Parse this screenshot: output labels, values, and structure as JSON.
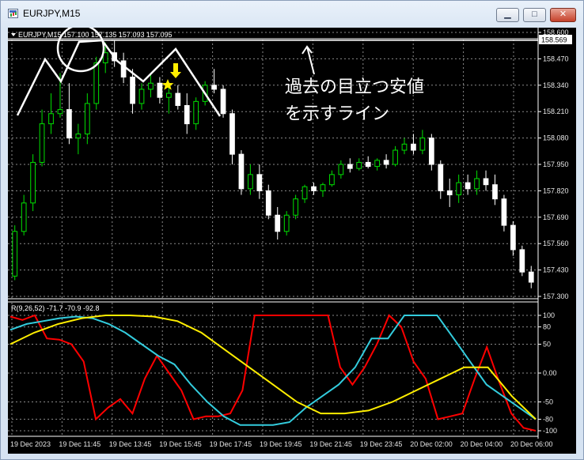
{
  "window": {
    "title": "EURJPY,M15",
    "min_glyph": "▁",
    "max_glyph": "□",
    "close_glyph": "✕"
  },
  "main_chart": {
    "header": "EURJPY,M15  157.100 157.135 157.093 157.095",
    "current_price": "158.569",
    "price_ticks": [
      "158.600",
      "158.470",
      "158.340",
      "158.210",
      "158.080",
      "157.950",
      "157.820",
      "157.690",
      "157.560",
      "157.430",
      "157.300"
    ],
    "price_range": [
      157.3,
      158.6
    ],
    "annotation_line1": "過去の目立つ安値",
    "annotation_line2": "を示すライン"
  },
  "indicator": {
    "header": "R(9,26,52) -71.7 -70.9 -92.8",
    "ticks": [
      "100",
      "80",
      "50",
      "0.00",
      "-50",
      "-80",
      "-100"
    ],
    "range": [
      -100,
      100
    ]
  },
  "time_axis": [
    "19 Dec 2023",
    "19 Dec 11:45",
    "19 Dec 13:45",
    "19 Dec 15:45",
    "19 Dec 17:45",
    "19 Dec 19:45",
    "19 Dec 21:45",
    "19 Dec 23:45",
    "20 Dec 02:00",
    "20 Dec 04:00",
    "20 Dec 06:00"
  ],
  "colors": {
    "up_candle": "#00e000",
    "down_candle": "#ffffff",
    "background": "#000000",
    "grid": "#8a8a8a",
    "price_line": "#ffffff",
    "red_line": "#ff0000",
    "cyan_line": "#33ccdd",
    "yellow_line": "#ffee00",
    "arrow": "#ffee00"
  },
  "chart_data": {
    "type": "candlestick",
    "title": "EURJPY,M15",
    "ylim": [
      157.3,
      158.6
    ],
    "candles": [
      {
        "o": 157.4,
        "h": 157.65,
        "l": 157.38,
        "c": 157.62
      },
      {
        "o": 157.62,
        "h": 157.8,
        "l": 157.6,
        "c": 157.76
      },
      {
        "o": 157.76,
        "h": 158.0,
        "l": 157.72,
        "c": 157.96
      },
      {
        "o": 157.96,
        "h": 158.22,
        "l": 157.94,
        "c": 158.15
      },
      {
        "o": 158.15,
        "h": 158.3,
        "l": 158.1,
        "c": 158.2
      },
      {
        "o": 158.2,
        "h": 158.4,
        "l": 158.18,
        "c": 158.22
      },
      {
        "o": 158.22,
        "h": 158.35,
        "l": 158.05,
        "c": 158.08
      },
      {
        "o": 158.08,
        "h": 158.15,
        "l": 158.0,
        "c": 158.1
      },
      {
        "o": 158.1,
        "h": 158.3,
        "l": 158.05,
        "c": 158.25
      },
      {
        "o": 158.25,
        "h": 158.48,
        "l": 158.22,
        "c": 158.45
      },
      {
        "o": 158.45,
        "h": 158.55,
        "l": 158.4,
        "c": 158.5
      },
      {
        "o": 158.5,
        "h": 158.56,
        "l": 158.43,
        "c": 158.46
      },
      {
        "o": 158.46,
        "h": 158.5,
        "l": 158.35,
        "c": 158.38
      },
      {
        "o": 158.38,
        "h": 158.42,
        "l": 158.2,
        "c": 158.25
      },
      {
        "o": 158.25,
        "h": 158.35,
        "l": 158.22,
        "c": 158.32
      },
      {
        "o": 158.32,
        "h": 158.4,
        "l": 158.28,
        "c": 158.35
      },
      {
        "o": 158.35,
        "h": 158.38,
        "l": 158.25,
        "c": 158.28
      },
      {
        "o": 158.28,
        "h": 158.34,
        "l": 158.2,
        "c": 158.3
      },
      {
        "o": 158.3,
        "h": 158.34,
        "l": 158.22,
        "c": 158.24
      },
      {
        "o": 158.24,
        "h": 158.3,
        "l": 158.1,
        "c": 158.15
      },
      {
        "o": 158.15,
        "h": 158.28,
        "l": 158.12,
        "c": 158.26
      },
      {
        "o": 158.26,
        "h": 158.36,
        "l": 158.24,
        "c": 158.34
      },
      {
        "o": 158.34,
        "h": 158.42,
        "l": 158.3,
        "c": 158.32
      },
      {
        "o": 158.32,
        "h": 158.34,
        "l": 158.18,
        "c": 158.2
      },
      {
        "o": 158.2,
        "h": 158.22,
        "l": 157.95,
        "c": 158.0
      },
      {
        "o": 158.0,
        "h": 158.02,
        "l": 157.8,
        "c": 157.83
      },
      {
        "o": 157.83,
        "h": 157.95,
        "l": 157.8,
        "c": 157.9
      },
      {
        "o": 157.9,
        "h": 157.95,
        "l": 157.78,
        "c": 157.82
      },
      {
        "o": 157.82,
        "h": 157.85,
        "l": 157.68,
        "c": 157.7
      },
      {
        "o": 157.7,
        "h": 157.74,
        "l": 157.58,
        "c": 157.62
      },
      {
        "o": 157.62,
        "h": 157.72,
        "l": 157.6,
        "c": 157.7
      },
      {
        "o": 157.7,
        "h": 157.8,
        "l": 157.68,
        "c": 157.78
      },
      {
        "o": 157.78,
        "h": 157.85,
        "l": 157.76,
        "c": 157.84
      },
      {
        "o": 157.84,
        "h": 157.86,
        "l": 157.8,
        "c": 157.82
      },
      {
        "o": 157.82,
        "h": 157.86,
        "l": 157.79,
        "c": 157.85
      },
      {
        "o": 157.85,
        "h": 157.92,
        "l": 157.84,
        "c": 157.9
      },
      {
        "o": 157.9,
        "h": 157.97,
        "l": 157.88,
        "c": 157.95
      },
      {
        "o": 157.95,
        "h": 157.98,
        "l": 157.91,
        "c": 157.93
      },
      {
        "o": 157.93,
        "h": 157.98,
        "l": 157.92,
        "c": 157.96
      },
      {
        "o": 157.96,
        "h": 157.99,
        "l": 157.93,
        "c": 157.94
      },
      {
        "o": 157.94,
        "h": 157.98,
        "l": 157.92,
        "c": 157.97
      },
      {
        "o": 157.97,
        "h": 158.0,
        "l": 157.93,
        "c": 157.95
      },
      {
        "o": 157.95,
        "h": 158.04,
        "l": 157.94,
        "c": 158.02
      },
      {
        "o": 158.02,
        "h": 158.08,
        "l": 158.0,
        "c": 158.05
      },
      {
        "o": 158.05,
        "h": 158.1,
        "l": 158.0,
        "c": 158.02
      },
      {
        "o": 158.02,
        "h": 158.12,
        "l": 158.0,
        "c": 158.08
      },
      {
        "o": 158.08,
        "h": 158.1,
        "l": 157.92,
        "c": 157.95
      },
      {
        "o": 157.95,
        "h": 157.97,
        "l": 157.78,
        "c": 157.82
      },
      {
        "o": 157.82,
        "h": 157.88,
        "l": 157.74,
        "c": 157.8
      },
      {
        "o": 157.8,
        "h": 157.9,
        "l": 157.76,
        "c": 157.86
      },
      {
        "o": 157.86,
        "h": 157.9,
        "l": 157.8,
        "c": 157.83
      },
      {
        "o": 157.83,
        "h": 157.92,
        "l": 157.8,
        "c": 157.88
      },
      {
        "o": 157.88,
        "h": 157.92,
        "l": 157.82,
        "c": 157.85
      },
      {
        "o": 157.85,
        "h": 157.9,
        "l": 157.75,
        "c": 157.78
      },
      {
        "o": 157.78,
        "h": 157.8,
        "l": 157.62,
        "c": 157.65
      },
      {
        "o": 157.65,
        "h": 157.67,
        "l": 157.5,
        "c": 157.53
      },
      {
        "o": 157.53,
        "h": 157.55,
        "l": 157.4,
        "c": 157.42
      },
      {
        "o": 157.42,
        "h": 157.45,
        "l": 157.34,
        "c": 157.37
      }
    ],
    "indicator": {
      "name": "R(9,26,52)",
      "ylim": [
        -100,
        100
      ],
      "series": [
        {
          "color": "red",
          "values": [
            98,
            92,
            100,
            60,
            58,
            50,
            20,
            -80,
            -60,
            -45,
            -70,
            -10,
            30,
            0,
            -30,
            -80,
            -75,
            -75,
            -70,
            -30,
            100,
            100,
            100,
            100,
            100,
            100,
            100,
            10,
            -20,
            10,
            50,
            100,
            80,
            20,
            -10,
            -80,
            -75,
            -70,
            -10,
            45,
            -15,
            -70,
            -95,
            -100
          ]
        },
        {
          "color": "cyan",
          "values": [
            75,
            85,
            90,
            95,
            98,
            95,
            85,
            70,
            50,
            30,
            15,
            -20,
            -50,
            -75,
            -90,
            -90,
            -90,
            -85,
            -60,
            -40,
            -20,
            10,
            60,
            60,
            100,
            100,
            100,
            60,
            20,
            -20,
            -40,
            -60,
            -80
          ]
        },
        {
          "color": "yellow",
          "values": [
            50,
            70,
            85,
            95,
            100,
            100,
            98,
            90,
            70,
            40,
            10,
            -20,
            -50,
            -70,
            -70,
            -65,
            -50,
            -30,
            -10,
            10,
            10,
            -40,
            -80
          ]
        }
      ]
    }
  }
}
